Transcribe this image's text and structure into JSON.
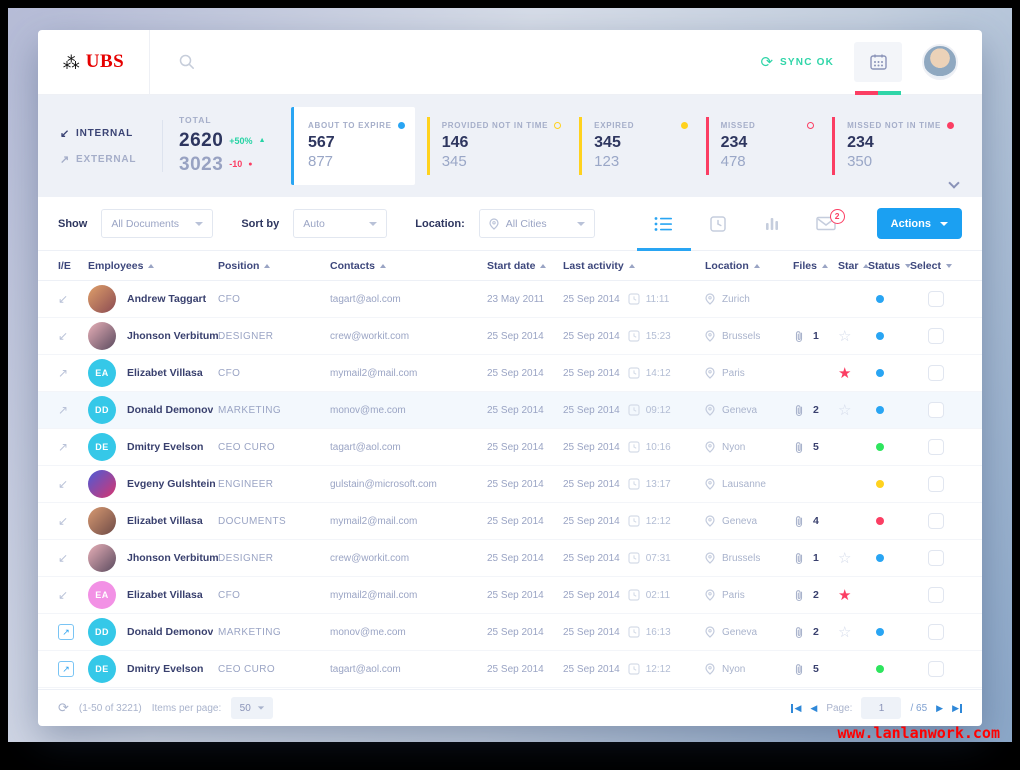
{
  "brand": {
    "name": "UBS"
  },
  "topbar": {
    "sync_label": "SYNC OK"
  },
  "icons": {
    "internal": "↙",
    "external": "↗",
    "link_arrow": "↗",
    "sync": "⟳",
    "refresh": "⟳",
    "keys": "⁂",
    "star_outline": "☆",
    "star_filled": "★",
    "prev": "◀",
    "next": "▶",
    "delta_up": "▲",
    "delta_down": "●"
  },
  "stats": {
    "internal_label": "INTERNAL",
    "external_label": "EXTERNAL",
    "total_label": "TOTAL",
    "internal_total": "2620",
    "internal_delta": "+50%",
    "external_total": "3023",
    "external_delta": "-10",
    "cards": [
      {
        "label": "ABOUT TO EXPIRE",
        "value": "567",
        "secondary": "877",
        "color": "#29a5f3",
        "dot": "filled",
        "selected": true
      },
      {
        "label": "PROVIDED NOT IN TIME",
        "value": "146",
        "secondary": "345",
        "color": "#ffd21e",
        "dot": "outline",
        "selected": false
      },
      {
        "label": "EXPIRED",
        "value": "345",
        "secondary": "123",
        "color": "#ffd21e",
        "dot": "filled",
        "selected": false
      },
      {
        "label": "MISSED",
        "value": "234",
        "secondary": "478",
        "color": "#fb3e63",
        "dot": "outline",
        "selected": false
      },
      {
        "label": "MISSED NOT IN TIME",
        "value": "234",
        "secondary": "350",
        "color": "#fb3e63",
        "dot": "filled",
        "selected": false
      }
    ]
  },
  "filters": {
    "show_label": "Show",
    "show_value": "All Documents",
    "sort_label": "Sort by",
    "sort_value": "Auto",
    "location_label": "Location:",
    "location_value": "All Cities",
    "mail_badge": "2",
    "actions_label": "Actions"
  },
  "table": {
    "columns": [
      {
        "key": "ie",
        "label": "I/E",
        "sort": null
      },
      {
        "key": "employees",
        "label": "Employees",
        "sort": "asc"
      },
      {
        "key": "position",
        "label": "Position",
        "sort": "asc"
      },
      {
        "key": "contacts",
        "label": "Contacts",
        "sort": "asc"
      },
      {
        "key": "start",
        "label": "Start date",
        "sort": "asc"
      },
      {
        "key": "activity",
        "label": "Last activity",
        "sort": "asc"
      },
      {
        "key": "location",
        "label": "Location",
        "sort": "asc"
      },
      {
        "key": "files",
        "label": "Files",
        "sort": "asc"
      },
      {
        "key": "star",
        "label": "Star",
        "sort": "asc"
      },
      {
        "key": "status",
        "label": "Status",
        "sort": "desc"
      },
      {
        "key": "select",
        "label": "Select",
        "sort": "desc"
      }
    ],
    "rows": [
      {
        "direction": "internal",
        "avatar_type": "photo",
        "avatar_text": "",
        "avatar_colors": [
          "#e0a06a",
          "#8a4a52"
        ],
        "name": "Andrew Taggart",
        "position": "CFO",
        "email": "tagart@aol.com",
        "start_date": "23 May 2011",
        "activity_date": "25 Sep 2014",
        "activity_time": "11:11",
        "location": "Zurich",
        "files": "",
        "star": "none",
        "status": "#29a5f3",
        "highlight": false
      },
      {
        "direction": "internal",
        "avatar_type": "photo",
        "avatar_text": "",
        "avatar_colors": [
          "#e8b0b8",
          "#5a4a5e"
        ],
        "name": "Jhonson Verbitum",
        "position": "DESIGNER",
        "email": "crew@workit.com",
        "start_date": "25 Sep 2014",
        "activity_date": "25 Sep 2014",
        "activity_time": "15:23",
        "location": "Brussels",
        "files": "1",
        "star": "outline",
        "status": "#29a5f3",
        "highlight": false
      },
      {
        "direction": "external",
        "avatar_type": "initials",
        "avatar_text": "EA",
        "avatar_colors": [
          "#35c8e8",
          "#35c8e8"
        ],
        "name": "Elizabet Villasa",
        "position": "CFO",
        "email": "mymail2@mail.com",
        "start_date": "25 Sep 2014",
        "activity_date": "25 Sep 2014",
        "activity_time": "14:12",
        "location": "Paris",
        "files": "",
        "star": "filled",
        "status": "#29a5f3",
        "highlight": false
      },
      {
        "direction": "external",
        "avatar_type": "initials",
        "avatar_text": "DD",
        "avatar_colors": [
          "#35c8e8",
          "#35c8e8"
        ],
        "name": "Donald Demonov",
        "position": "MARKETING",
        "email": "monov@me.com",
        "start_date": "25 Sep 2014",
        "activity_date": "25 Sep 2014",
        "activity_time": "09:12",
        "location": "Geneva",
        "files": "2",
        "star": "outline",
        "status": "#29a5f3",
        "highlight": true
      },
      {
        "direction": "external",
        "avatar_type": "initials",
        "avatar_text": "DE",
        "avatar_colors": [
          "#35c8e8",
          "#35c8e8"
        ],
        "name": "Dmitry Evelson",
        "position": "CEO CURO",
        "email": "tagart@aol.com",
        "start_date": "25 Sep 2014",
        "activity_date": "25 Sep 2014",
        "activity_time": "10:16",
        "location": "Nyon",
        "files": "5",
        "star": "none",
        "status": "#2ee55e",
        "highlight": false
      },
      {
        "direction": "internal",
        "avatar_type": "photo",
        "avatar_text": "",
        "avatar_colors": [
          "#4a5bd8",
          "#d8356e"
        ],
        "name": "Evgeny Gulshtein",
        "position": "ENGINEER",
        "email": "gulstain@microsoft.com",
        "start_date": "25 Sep 2014",
        "activity_date": "25 Sep 2014",
        "activity_time": "13:17",
        "location": "Lausanne",
        "files": "",
        "star": "none",
        "status": "#ffd21e",
        "highlight": false
      },
      {
        "direction": "internal",
        "avatar_type": "photo",
        "avatar_text": "",
        "avatar_colors": [
          "#d89a72",
          "#6e4a46"
        ],
        "name": "Elizabet Villasa",
        "position": "DOCUMENTS",
        "email": "mymail2@mail.com",
        "start_date": "25 Sep 2014",
        "activity_date": "25 Sep 2014",
        "activity_time": "12:12",
        "location": "Geneva",
        "files": "4",
        "star": "none",
        "status": "#fb3e63",
        "highlight": false
      },
      {
        "direction": "internal",
        "avatar_type": "photo",
        "avatar_text": "",
        "avatar_colors": [
          "#e8b0b8",
          "#5a4a5e"
        ],
        "name": "Jhonson Verbitum",
        "position": "DESIGNER",
        "email": "crew@workit.com",
        "start_date": "25 Sep 2014",
        "activity_date": "25 Sep 2014",
        "activity_time": "07:31",
        "location": "Brussels",
        "files": "1",
        "star": "outline",
        "status": "#29a5f3",
        "highlight": false
      },
      {
        "direction": "internal",
        "avatar_type": "initials",
        "avatar_text": "EA",
        "avatar_colors": [
          "#f291e5",
          "#f291e5"
        ],
        "name": "Elizabet Villasa",
        "position": "CFO",
        "email": "mymail2@mail.com",
        "start_date": "25 Sep 2014",
        "activity_date": "25 Sep 2014",
        "activity_time": "02:11",
        "location": "Paris",
        "files": "2",
        "star": "filled",
        "status": "",
        "highlight": false
      },
      {
        "direction": "link",
        "avatar_type": "initials",
        "avatar_text": "DD",
        "avatar_colors": [
          "#35c8e8",
          "#35c8e8"
        ],
        "name": "Donald Demonov",
        "position": "MARKETING",
        "email": "monov@me.com",
        "start_date": "25 Sep 2014",
        "activity_date": "25 Sep 2014",
        "activity_time": "16:13",
        "location": "Geneva",
        "files": "2",
        "star": "outline",
        "status": "#29a5f3",
        "highlight": false
      },
      {
        "direction": "link",
        "avatar_type": "initials",
        "avatar_text": "DE",
        "avatar_colors": [
          "#35c8e8",
          "#35c8e8"
        ],
        "name": "Dmitry Evelson",
        "position": "CEO CURO",
        "email": "tagart@aol.com",
        "start_date": "25 Sep 2014",
        "activity_date": "25 Sep 2014",
        "activity_time": "12:12",
        "location": "Nyon",
        "files": "5",
        "star": "none",
        "status": "#2ee55e",
        "highlight": false
      }
    ]
  },
  "footer": {
    "range_text": "(1-50 of 3221)",
    "items_per_page_label": "Items per page:",
    "items_per_page_value": "50",
    "page_label": "Page:",
    "page_value": "1",
    "page_total": "/ 65"
  },
  "watermark": "www.lanlanwork.com"
}
